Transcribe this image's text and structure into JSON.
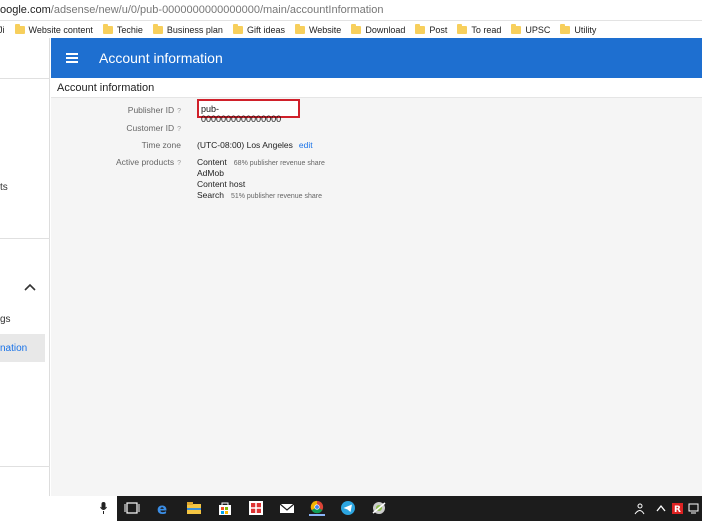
{
  "browser": {
    "url_host": "oogle.com",
    "url_path": "/adsense/new/u/0/pub-0000000000000000/main/accountInformation"
  },
  "bookmarks": [
    {
      "label": "Ji",
      "icon": "folder-icon"
    },
    {
      "label": "Website content",
      "icon": "folder-icon"
    },
    {
      "label": "Techie",
      "icon": "folder-icon"
    },
    {
      "label": "Business plan",
      "icon": "folder-icon"
    },
    {
      "label": "Gift ideas",
      "icon": "folder-icon"
    },
    {
      "label": "Website",
      "icon": "folder-icon"
    },
    {
      "label": "Download",
      "icon": "folder-icon"
    },
    {
      "label": "Post",
      "icon": "folder-icon"
    },
    {
      "label": "To read",
      "icon": "folder-icon"
    },
    {
      "label": "UPSC",
      "icon": "folder-icon"
    },
    {
      "label": "Utility",
      "icon": "folder-icon"
    }
  ],
  "sidebar": {
    "item_ts": "ts",
    "item_gs": "gs",
    "item_active": "nation"
  },
  "header": {
    "title": "Account information",
    "menu_icon": "hamburger-menu-icon"
  },
  "section": {
    "title": "Account information"
  },
  "fields": {
    "publisher_id_label": "Publisher ID",
    "publisher_id_value": "pub-0000000000000000",
    "customer_id_label": "Customer ID",
    "timezone_label": "Time zone",
    "timezone_value": "(UTC-08:00) Los Angeles",
    "timezone_edit": "edit",
    "active_products_label": "Active products",
    "help_mark": "?"
  },
  "products": [
    {
      "name": "Content",
      "share": "68% publisher revenue share"
    },
    {
      "name": "AdMob",
      "share": ""
    },
    {
      "name": "Content host",
      "share": ""
    },
    {
      "name": "Search",
      "share": "51% publisher revenue share"
    }
  ],
  "colors": {
    "header_blue": "#1e6fd0",
    "highlight_red": "#d0202a",
    "link_blue": "#1a73e8"
  }
}
